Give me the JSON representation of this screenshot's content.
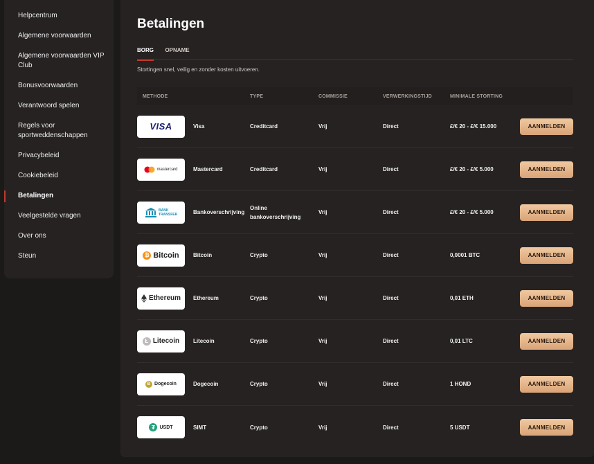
{
  "sidebar": {
    "items": [
      {
        "label": "Helpcentrum"
      },
      {
        "label": "Algemene voorwaarden"
      },
      {
        "label": "Algemene voorwaarden VIP Club"
      },
      {
        "label": "Bonusvoorwaarden"
      },
      {
        "label": "Verantwoord spelen"
      },
      {
        "label": "Regels voor sportweddenschappen"
      },
      {
        "label": "Privacybeleid"
      },
      {
        "label": "Cookiebeleid"
      },
      {
        "label": "Betalingen"
      },
      {
        "label": "Veelgestelde vragen"
      },
      {
        "label": "Over ons"
      },
      {
        "label": "Steun"
      }
    ],
    "active_index": 8
  },
  "main": {
    "title": "Betalingen",
    "tabs": [
      {
        "label": "BORG"
      },
      {
        "label": "OPNAME"
      }
    ],
    "active_tab": 0,
    "subtitle": "Stortingen snel, veilig en zonder kosten uitvoeren.",
    "table": {
      "headers": {
        "method": "METHODE",
        "type": "TYPE",
        "commission": "COMMISSIE",
        "processing": "VERWERKINGSTIJD",
        "minimum": "MINIMALE STORTING"
      },
      "rows": [
        {
          "logo_text": "VISA",
          "icon": "visa-logo",
          "name": "Visa",
          "type": "Creditcard",
          "commission": "Vrij",
          "processing": "Direct",
          "minimum": "£/€ 20 - £/€ 15.000",
          "button": "AANMELDEN"
        },
        {
          "logo_text": "mastercard",
          "icon": "mastercard-logo",
          "name": "Mastercard",
          "type": "Creditcard",
          "commission": "Vrij",
          "processing": "Direct",
          "minimum": "£/€ 20 - £/€ 5.000",
          "button": "AANMELDEN"
        },
        {
          "logo_text": "BANK TRANSFER",
          "icon": "bank-logo",
          "name": "Bankoverschrijving",
          "type": "Online bankoverschrijving",
          "commission": "Vrij",
          "processing": "Direct",
          "minimum": "£/€ 20 - £/€ 5.000",
          "button": "AANMELDEN"
        },
        {
          "logo_text": "Bitcoin",
          "icon": "bitcoin-logo",
          "name": "Bitcoin",
          "type": "Crypto",
          "commission": "Vrij",
          "processing": "Direct",
          "minimum": "0,0001 BTC",
          "button": "AANMELDEN"
        },
        {
          "logo_text": "Ethereum",
          "icon": "ethereum-logo",
          "name": "Ethereum",
          "type": "Crypto",
          "commission": "Vrij",
          "processing": "Direct",
          "minimum": "0,01 ETH",
          "button": "AANMELDEN"
        },
        {
          "logo_text": "Litecoin",
          "icon": "litecoin-logo",
          "name": "Litecoin",
          "type": "Crypto",
          "commission": "Vrij",
          "processing": "Direct",
          "minimum": "0,01 LTC",
          "button": "AANMELDEN"
        },
        {
          "logo_text": "Dogecoin",
          "icon": "dogecoin-logo",
          "name": "Dogecoin",
          "type": "Crypto",
          "commission": "Vrij",
          "processing": "Direct",
          "minimum": "1 HOND",
          "button": "AANMELDEN"
        },
        {
          "logo_text": "USDT",
          "icon": "tether-logo",
          "name": "SIMT",
          "type": "Crypto",
          "commission": "Vrij",
          "processing": "Direct",
          "minimum": "5 USDT",
          "button": "AANMELDEN"
        }
      ]
    }
  },
  "colors": {
    "background": "#1c1a19",
    "panel": "#262222",
    "accent": "#c0392b",
    "button": "#e8b88c"
  }
}
